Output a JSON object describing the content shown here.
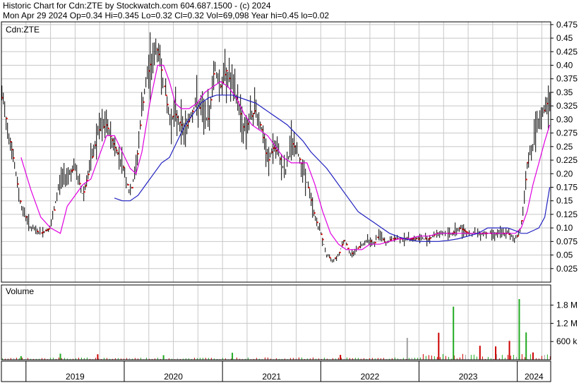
{
  "header": {
    "title": "Historic Chart for Cdn:ZTE by Stockwatch.com 604.687.1500 - (c) 2024",
    "quote": "Mon Apr 29 2024  Op=0.34  Hi=0.345  Lo=0.32  Cl=0.32  Vol=69,098  Year hi=0.45  lo=0.02"
  },
  "colors": {
    "background": "#ffffff",
    "grid": "#c8c8c8",
    "frame": "#000000",
    "price_bar": "#000000",
    "close_tick": "#e00000",
    "ma_short": "#e000e0",
    "ma_long": "#2020c0",
    "vol_up": "#22aa22",
    "vol_down": "#cc0000",
    "vol_flat": "#a0a0a0"
  },
  "chart_data": [
    {
      "type": "line",
      "panel": "price",
      "label": "Cdn:ZTE",
      "y_ticks": [
        "0.475",
        "0.45",
        "0.425",
        "0.40",
        "0.375",
        "0.35",
        "0.325",
        "0.30",
        "0.275",
        "0.25",
        "0.225",
        "0.20",
        "0.175",
        "0.15",
        "0.125",
        "0.10",
        "0.075",
        "0.05",
        "0.025"
      ],
      "ylim": [
        0,
        0.48
      ],
      "x_years": [
        "2019",
        "2020",
        "2021",
        "2022",
        "2023",
        "2024"
      ],
      "x_range": [
        2018.75,
        2024.34
      ],
      "grid": true,
      "price_points": {
        "x": [
          2018.76,
          2018.86,
          2018.95,
          2019.05,
          2019.15,
          2019.25,
          2019.35,
          2019.42,
          2019.5,
          2019.58,
          2019.66,
          2019.74,
          2019.82,
          2019.9,
          2019.98,
          2020.06,
          2020.12,
          2020.18,
          2020.26,
          2020.34,
          2020.4,
          2020.46,
          2020.52,
          2020.58,
          2020.62,
          2020.68,
          2020.74,
          2020.8,
          2020.86,
          2020.92,
          2020.98,
          2021.04,
          2021.1,
          2021.16,
          2021.22,
          2021.28,
          2021.34,
          2021.4,
          2021.46,
          2021.52,
          2021.58,
          2021.64,
          2021.7,
          2021.76,
          2021.82,
          2021.88,
          2021.94,
          2022.0,
          2022.06,
          2022.12,
          2022.18,
          2022.24,
          2022.3,
          2022.36,
          2022.42,
          2022.48,
          2022.54,
          2022.6,
          2022.66,
          2022.72,
          2022.78,
          2022.86,
          2022.94,
          2023.02,
          2023.1,
          2023.18,
          2023.26,
          2023.34,
          2023.42,
          2023.5,
          2023.58,
          2023.66,
          2023.74,
          2023.82,
          2023.9,
          2023.98,
          2024.02,
          2024.06,
          2024.1,
          2024.14,
          2024.18,
          2024.22,
          2024.26,
          2024.3,
          2024.33
        ],
        "y": [
          0.34,
          0.24,
          0.14,
          0.1,
          0.09,
          0.1,
          0.19,
          0.2,
          0.21,
          0.16,
          0.22,
          0.28,
          0.29,
          0.25,
          0.22,
          0.16,
          0.21,
          0.32,
          0.4,
          0.43,
          0.37,
          0.3,
          0.31,
          0.29,
          0.28,
          0.31,
          0.33,
          0.31,
          0.3,
          0.4,
          0.36,
          0.39,
          0.36,
          0.33,
          0.28,
          0.3,
          0.32,
          0.28,
          0.22,
          0.25,
          0.23,
          0.2,
          0.26,
          0.24,
          0.21,
          0.17,
          0.12,
          0.09,
          0.05,
          0.04,
          0.05,
          0.08,
          0.05,
          0.06,
          0.07,
          0.08,
          0.07,
          0.09,
          0.07,
          0.08,
          0.08,
          0.08,
          0.08,
          0.08,
          0.08,
          0.09,
          0.09,
          0.09,
          0.1,
          0.09,
          0.09,
          0.09,
          0.09,
          0.09,
          0.09,
          0.08,
          0.09,
          0.13,
          0.22,
          0.24,
          0.27,
          0.29,
          0.31,
          0.33,
          0.32
        ]
      },
      "series": [
        {
          "key": "ma_short",
          "x": [
            2018.95,
            2019.05,
            2019.15,
            2019.25,
            2019.35,
            2019.42,
            2019.5,
            2019.58,
            2019.66,
            2019.74,
            2019.82,
            2019.9,
            2019.98,
            2020.06,
            2020.12,
            2020.18,
            2020.26,
            2020.34,
            2020.4,
            2020.46,
            2020.52,
            2020.58,
            2020.66,
            2020.74,
            2020.82,
            2020.9,
            2020.98,
            2021.06,
            2021.14,
            2021.22,
            2021.3,
            2021.38,
            2021.46,
            2021.54,
            2021.62,
            2021.7,
            2021.78,
            2021.86,
            2021.94,
            2022.02,
            2022.1,
            2022.18,
            2022.26,
            2022.34,
            2022.42,
            2022.5,
            2022.6,
            2022.7,
            2022.8,
            2022.9,
            2023.0,
            2023.1,
            2023.2,
            2023.3,
            2023.4,
            2023.5,
            2023.6,
            2023.7,
            2023.8,
            2023.9,
            2023.98,
            2024.04,
            2024.1,
            2024.16,
            2024.22,
            2024.28,
            2024.33
          ],
          "y": [
            0.23,
            0.17,
            0.12,
            0.1,
            0.09,
            0.14,
            0.16,
            0.18,
            0.19,
            0.23,
            0.27,
            0.27,
            0.24,
            0.21,
            0.2,
            0.24,
            0.33,
            0.4,
            0.4,
            0.37,
            0.33,
            0.32,
            0.32,
            0.33,
            0.35,
            0.36,
            0.37,
            0.36,
            0.34,
            0.31,
            0.29,
            0.28,
            0.27,
            0.25,
            0.23,
            0.22,
            0.22,
            0.22,
            0.18,
            0.13,
            0.09,
            0.07,
            0.06,
            0.06,
            0.06,
            0.07,
            0.07,
            0.075,
            0.08,
            0.08,
            0.085,
            0.085,
            0.09,
            0.09,
            0.09,
            0.09,
            0.09,
            0.09,
            0.09,
            0.09,
            0.09,
            0.1,
            0.13,
            0.18,
            0.22,
            0.26,
            0.29
          ]
        },
        {
          "key": "ma_long",
          "x": [
            2019.9,
            2019.98,
            2020.06,
            2020.14,
            2020.22,
            2020.3,
            2020.38,
            2020.46,
            2020.54,
            2020.62,
            2020.7,
            2020.78,
            2020.86,
            2020.94,
            2021.02,
            2021.1,
            2021.18,
            2021.26,
            2021.34,
            2021.42,
            2021.5,
            2021.58,
            2021.66,
            2021.74,
            2021.82,
            2021.9,
            2021.98,
            2022.06,
            2022.14,
            2022.22,
            2022.3,
            2022.38,
            2022.46,
            2022.54,
            2022.62,
            2022.7,
            2022.8,
            2022.9,
            2023.0,
            2023.1,
            2023.2,
            2023.3,
            2023.4,
            2023.5,
            2023.6,
            2023.7,
            2023.8,
            2023.9,
            2023.98,
            2024.04,
            2024.1,
            2024.16,
            2024.22,
            2024.28,
            2024.33
          ],
          "y": [
            0.155,
            0.15,
            0.15,
            0.16,
            0.18,
            0.2,
            0.22,
            0.23,
            0.26,
            0.29,
            0.31,
            0.33,
            0.34,
            0.345,
            0.345,
            0.345,
            0.34,
            0.335,
            0.33,
            0.32,
            0.31,
            0.3,
            0.29,
            0.275,
            0.26,
            0.24,
            0.225,
            0.21,
            0.19,
            0.17,
            0.15,
            0.13,
            0.12,
            0.11,
            0.1,
            0.09,
            0.083,
            0.078,
            0.075,
            0.075,
            0.075,
            0.077,
            0.08,
            0.085,
            0.09,
            0.1,
            0.1,
            0.1,
            0.095,
            0.09,
            0.09,
            0.095,
            0.1,
            0.12,
            0.175
          ]
        }
      ]
    },
    {
      "type": "bar",
      "panel": "volume",
      "label": "Volume",
      "y_ticks": [
        "1.8 M",
        "1.2 M",
        "600 k"
      ],
      "ylim": [
        0,
        2000000
      ],
      "grid": true,
      "spikes": {
        "x": [
          2018.95,
          2019.35,
          2019.73,
          2020.4,
          2021.1,
          2022.2,
          2022.88,
          2023.2,
          2023.35,
          2023.62,
          2023.78,
          2023.92,
          2024.02,
          2024.09,
          2024.16
        ],
        "values": [
          120000,
          200000,
          180000,
          150000,
          230000,
          160000,
          720000,
          890000,
          1750000,
          460000,
          440000,
          620000,
          2000000,
          900000,
          240000
        ],
        "dir": [
          "up",
          "up",
          "down",
          "up",
          "up",
          "down",
          "flat",
          "down",
          "up",
          "down",
          "down",
          "down",
          "up",
          "up",
          "down"
        ]
      }
    }
  ]
}
